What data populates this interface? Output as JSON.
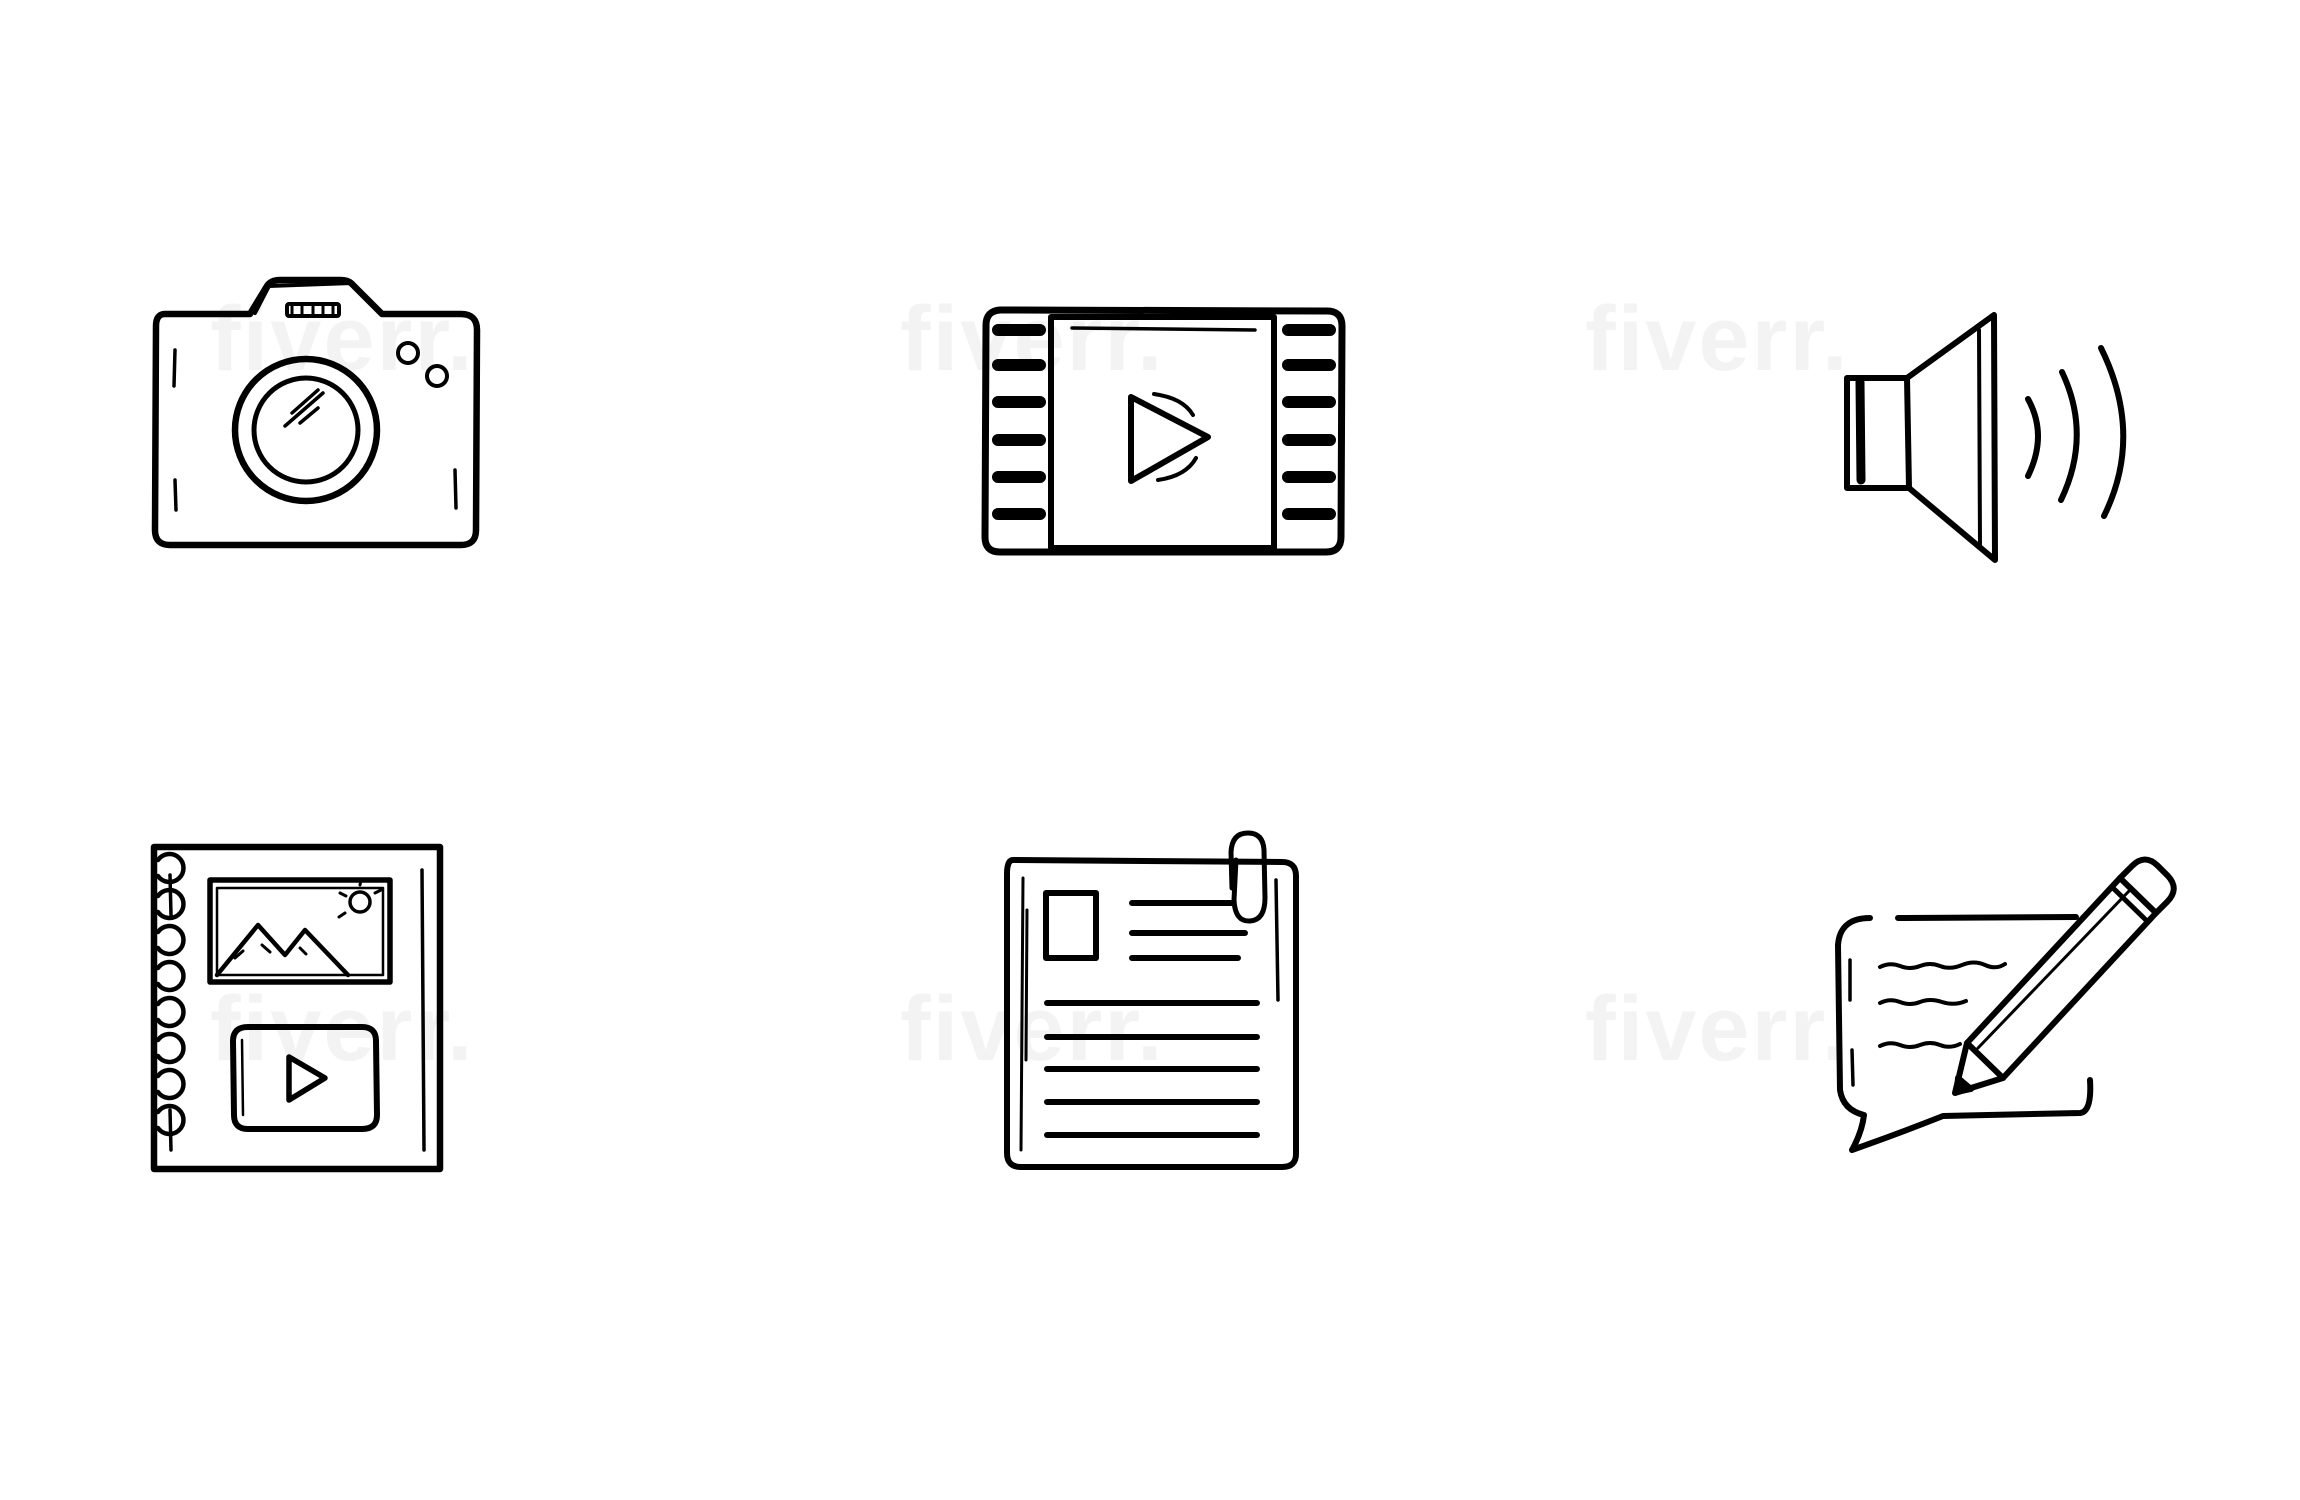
{
  "theme": {
    "background": "#ffffff",
    "ink": "#000000"
  },
  "watermark": {
    "text": "fiverr."
  },
  "icons": [
    {
      "name": "camera-icon"
    },
    {
      "name": "film-play-icon"
    },
    {
      "name": "speaker-icon"
    },
    {
      "name": "media-notebook-icon"
    },
    {
      "name": "document-clip-icon"
    },
    {
      "name": "chat-pencil-icon"
    }
  ]
}
